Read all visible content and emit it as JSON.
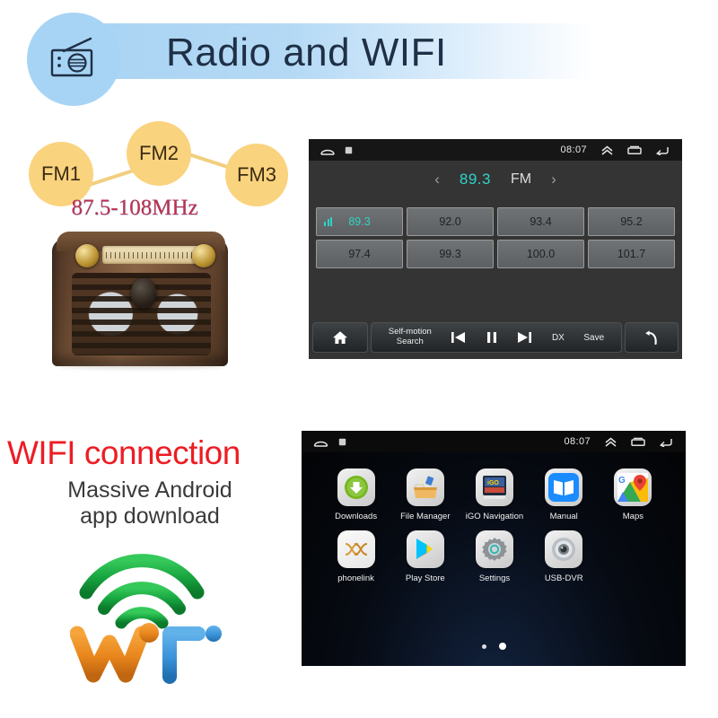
{
  "banner": {
    "title": "Radio and WIFI",
    "icon": "radio-icon",
    "bg_color": "#a9d4f3"
  },
  "fm_cluster": {
    "bubbles": [
      {
        "label": "FM1"
      },
      {
        "label": "FM2"
      },
      {
        "label": "FM3"
      }
    ],
    "frequency_range": "87.5-108MHz",
    "bubble_color": "#fad37f",
    "range_color": "#c0304f"
  },
  "radio_screen": {
    "status_bar": {
      "clock": "08:07",
      "left_icons": [
        "home-icon",
        "app-square-icon"
      ],
      "right_icons": [
        "chevron-up-icon",
        "recents-icon",
        "back-icon"
      ]
    },
    "tuner": {
      "prev_arrow": "‹",
      "next_arrow": "›",
      "frequency": "89.3",
      "band": "FM",
      "frequency_color": "#2fd3c6"
    },
    "presets": [
      {
        "value": "89.3",
        "active": true
      },
      {
        "value": "92.0",
        "active": false
      },
      {
        "value": "93.4",
        "active": false
      },
      {
        "value": "95.2",
        "active": false
      },
      {
        "value": "97.4",
        "active": false
      },
      {
        "value": "99.3",
        "active": false
      },
      {
        "value": "100.0",
        "active": false
      },
      {
        "value": "101.7",
        "active": false
      }
    ],
    "toolbar": {
      "home": "home-icon",
      "search_label_line1": "Self-motion",
      "search_label_line2": "Search",
      "prev": "skip-previous-icon",
      "pause": "pause-icon",
      "next": "skip-next-icon",
      "dx_label": "DX",
      "save_label": "Save",
      "back": "return-arrow-icon"
    }
  },
  "wifi_section": {
    "title": "WIFI connection",
    "subtitle_line1": "Massive Android",
    "subtitle_line2": "app download",
    "title_color": "#ed1c24",
    "logo": {
      "name": "wifi-3d-logo",
      "arc_color": "#17a33f",
      "wi_color": "#e8861c",
      "fi_color": "#3b93d9"
    }
  },
  "app_screen": {
    "status_bar": {
      "clock": "08:07",
      "left_icons": [
        "home-icon",
        "app-square-icon"
      ],
      "right_icons": [
        "chevron-up-icon",
        "recents-icon",
        "back-icon"
      ]
    },
    "apps": [
      {
        "label": "Downloads",
        "icon": "download-icon"
      },
      {
        "label": "File Manager",
        "icon": "file-manager-icon"
      },
      {
        "label": "iGO Navigation",
        "icon": "igo-navigation-icon"
      },
      {
        "label": "Manual",
        "icon": "book-icon"
      },
      {
        "label": "Maps",
        "icon": "maps-icon"
      },
      {
        "label": "phonelink",
        "icon": "phonelink-icon"
      },
      {
        "label": "Play Store",
        "icon": "play-store-icon"
      },
      {
        "label": "Settings",
        "icon": "gear-icon"
      },
      {
        "label": "USB-DVR",
        "icon": "usb-dvr-icon"
      }
    ],
    "page_dots": {
      "count": 2,
      "active_index": 1
    }
  }
}
